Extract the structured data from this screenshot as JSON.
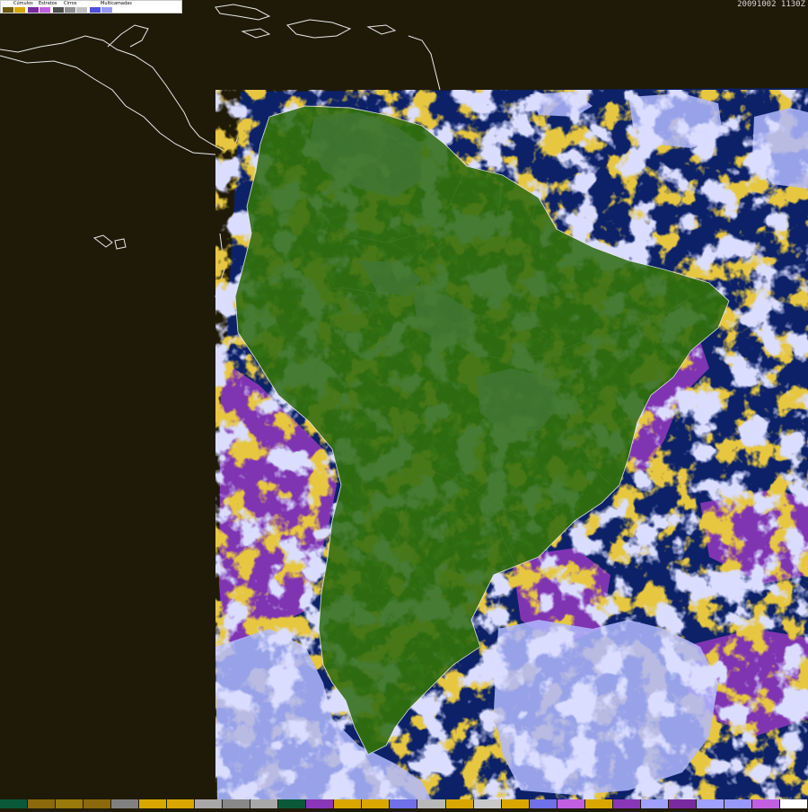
{
  "map": {
    "timestamp": "20091002 1130Z",
    "colors": {
      "background": "#1f1a08",
      "ocean": "#0c2168",
      "land": "#2d6a10",
      "land_dark": "#1f5308",
      "coastline": "#e8e8e8",
      "border": "#c8c8c8",
      "cumulus": "#c8920c",
      "stratus": "#8a36b8",
      "cirrus": "#9aa0a8",
      "multilayer": "#b0b8ff",
      "dense_cloud": "#e8ecff"
    }
  },
  "legend": {
    "categories": [
      {
        "label": "Cúmulos",
        "colors": [
          "#6b5a0a",
          "#d8a800"
        ]
      },
      {
        "label": "Estratos",
        "colors": [
          "#7a2aa0",
          "#c060e0"
        ]
      },
      {
        "label": "Cirros",
        "colors": [
          "#505050",
          "#909090",
          "#c0c0c0"
        ]
      },
      {
        "label": "Multicamadas",
        "colors": [
          "#5050e0",
          "#9898f8",
          "#ffffff"
        ]
      }
    ]
  },
  "bottom_bar": {
    "colors": [
      "#0a5a3a",
      "#8a6a0a",
      "#9a7a0a",
      "#8a6a0a",
      "#808080",
      "#d8a800",
      "#d8a800",
      "#a8a8a8",
      "#888888",
      "#a8a8a8",
      "#0a5a3a",
      "#8a36b8",
      "#d8a800",
      "#d8a800",
      "#7070e8",
      "#b8b8b8",
      "#d8a800",
      "#c8c8c8",
      "#d8a800",
      "#7070e8",
      "#c060e0",
      "#d8a800",
      "#8a36b8",
      "#a0a0ff",
      "#7a2aa0",
      "#a0a0ff",
      "#9898f8",
      "#c060e0",
      "#ffffff"
    ]
  }
}
